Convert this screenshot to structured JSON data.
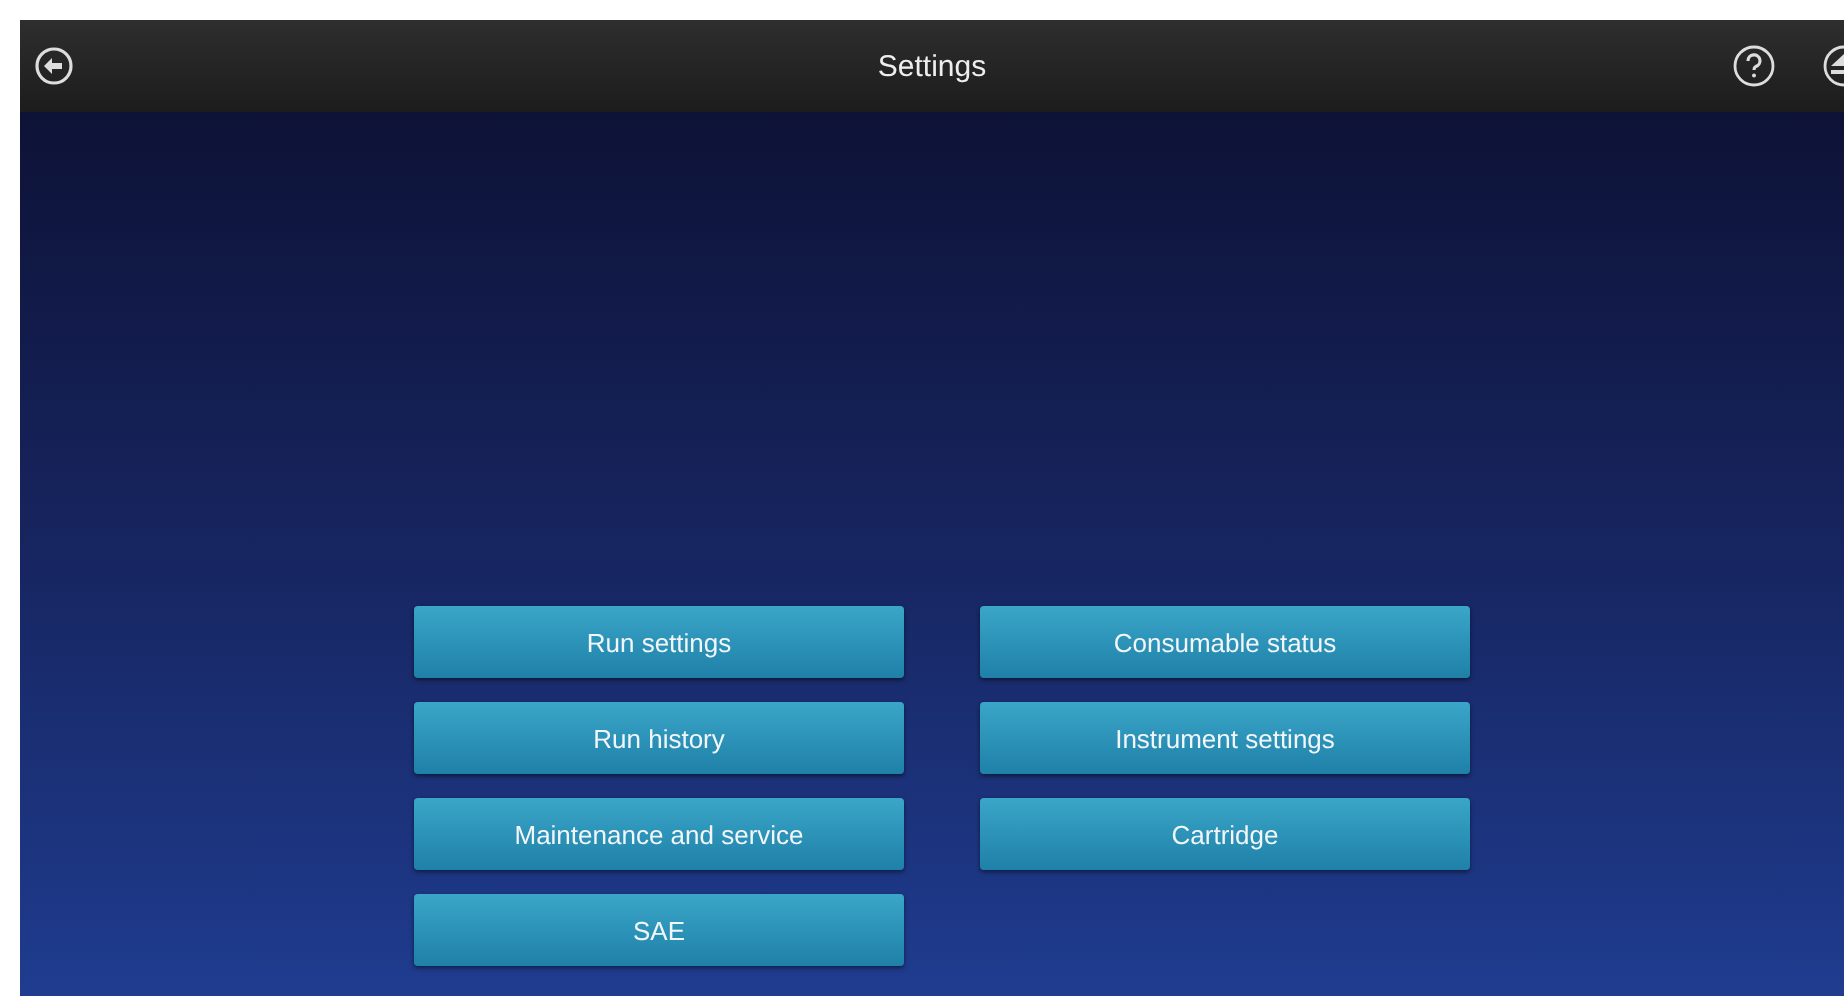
{
  "header": {
    "title": "Settings"
  },
  "menu_buttons": [
    {
      "label": "Run settings"
    },
    {
      "label": "Consumable status"
    },
    {
      "label": "Run history"
    },
    {
      "label": "Instrument settings"
    },
    {
      "label": "Maintenance and service"
    },
    {
      "label": "Cartridge"
    },
    {
      "label": "SAE"
    }
  ]
}
